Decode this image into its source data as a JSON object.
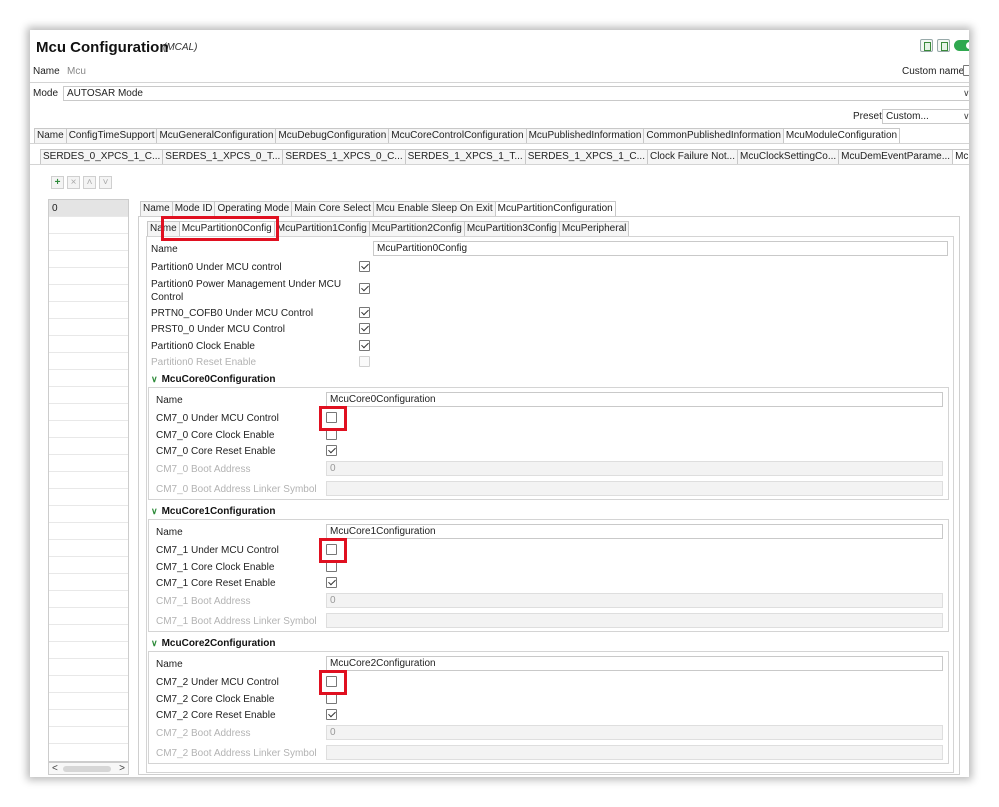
{
  "editor": {
    "title": "Mcu Configuration",
    "subtitle": "(MCAL)",
    "name_label": "Name",
    "name_value": "Mcu",
    "custom_name_label": "Custom name",
    "mode_label": "Mode",
    "mode_value": "AUTOSAR Mode",
    "preset_label": "Preset",
    "preset_value": "Custom..."
  },
  "main_tabs": [
    "Name",
    "ConfigTimeSupport",
    "McuGeneralConfiguration",
    "McuDebugConfiguration",
    "McuCoreControlConfiguration",
    "McuPublishedInformation",
    "CommonPublishedInformation",
    "McuModuleConfiguration"
  ],
  "sub_tabs": [
    "SERDES_0_XPCS_1_C...",
    "SERDES_1_XPCS_0_T...",
    "SERDES_1_XPCS_0_C...",
    "SERDES_1_XPCS_1_T...",
    "SERDES_1_XPCS_1_C...",
    "Clock Failure Not...",
    "McuClockSettingCo...",
    "McuDemEventParame...",
    "McuModeSettingConf",
    "»₇"
  ],
  "list": {
    "items": [
      "0"
    ]
  },
  "mode_tabs": [
    "Name",
    "Mode ID",
    "Operating Mode",
    "Main Core Select",
    "Mcu Enable Sleep On Exit",
    "McuPartitionConfiguration"
  ],
  "partition_tabs": [
    "Name",
    "McuPartition0Config",
    "McuPartition1Config",
    "McuPartition2Config",
    "McuPartition3Config",
    "McuPeripheral"
  ],
  "partition": {
    "name_label": "Name",
    "name_value": "McuPartition0Config",
    "rows": [
      {
        "label": "Partition0 Under MCU control",
        "checked": true,
        "disabled": false
      },
      {
        "label": "Partition0 Power Management Under MCU Control",
        "checked": true,
        "disabled": false
      },
      {
        "label": "PRTN0_COFB0 Under MCU Control",
        "checked": true,
        "disabled": false
      },
      {
        "label": "PRST0_0 Under MCU Control",
        "checked": true,
        "disabled": false
      },
      {
        "label": "Partition0 Clock Enable",
        "checked": true,
        "disabled": false
      },
      {
        "label": "Partition0 Reset Enable",
        "checked": false,
        "disabled": true
      }
    ]
  },
  "cores": [
    {
      "header": "McuCore0Configuration",
      "name_label": "Name",
      "name_value": "McuCore0Configuration",
      "under_label": "CM7_0 Under MCU Control",
      "under_checked": false,
      "clock_label": "CM7_0 Core Clock Enable",
      "clock_checked": false,
      "reset_label": "CM7_0 Core Reset Enable",
      "reset_checked": true,
      "boot_label": "CM7_0 Boot Address",
      "boot_value": "0",
      "linker_label": "CM7_0 Boot Address Linker Symbol"
    },
    {
      "header": "McuCore1Configuration",
      "name_label": "Name",
      "name_value": "McuCore1Configuration",
      "under_label": "CM7_1 Under MCU Control",
      "under_checked": false,
      "clock_label": "CM7_1 Core Clock Enable",
      "clock_checked": false,
      "reset_label": "CM7_1 Core Reset Enable",
      "reset_checked": true,
      "boot_label": "CM7_1 Boot Address",
      "boot_value": "0",
      "linker_label": "CM7_1 Boot Address Linker Symbol"
    },
    {
      "header": "McuCore2Configuration",
      "name_label": "Name",
      "name_value": "McuCore2Configuration",
      "under_label": "CM7_2 Under MCU Control",
      "under_checked": false,
      "clock_label": "CM7_2 Core Clock Enable",
      "clock_checked": false,
      "reset_label": "CM7_2 Core Reset Enable",
      "reset_checked": true,
      "boot_label": "CM7_2 Boot Address",
      "boot_value": "0",
      "linker_label": "CM7_2 Boot Address Linker Symbol"
    }
  ],
  "colors": {
    "accent_green": "#2fa84f",
    "highlight_red": "#e01020"
  }
}
